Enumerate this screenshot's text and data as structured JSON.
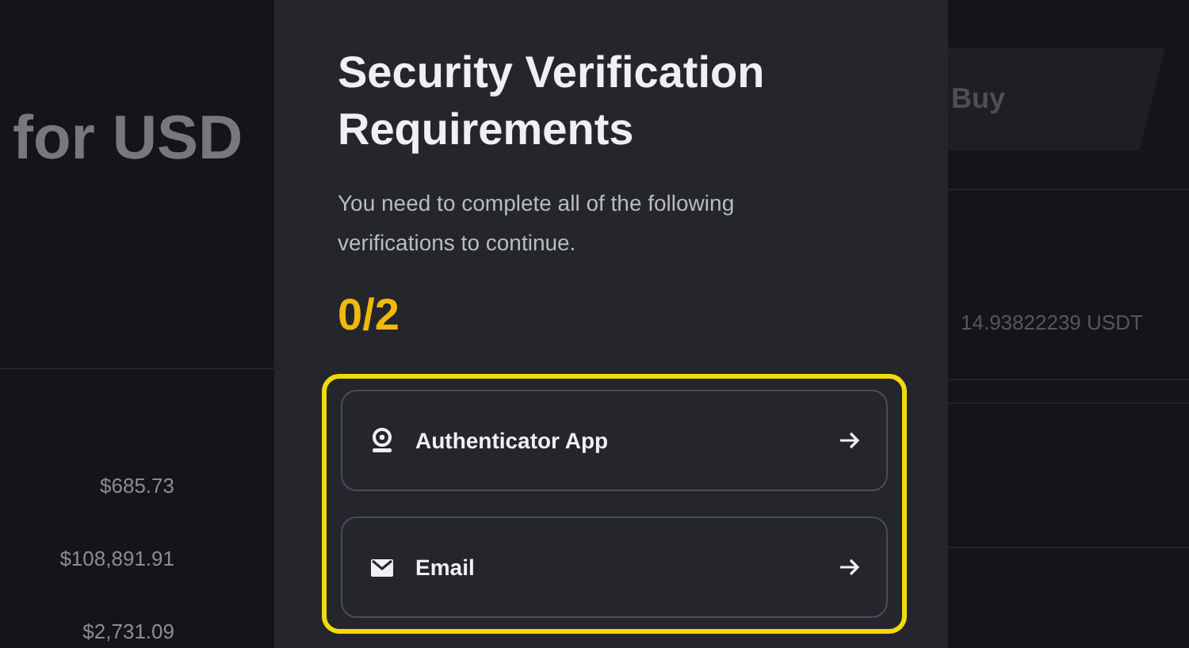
{
  "background_left": {
    "heading": "for USD",
    "prices": [
      "$685.73",
      "$108,891.91",
      "$2,731.09"
    ]
  },
  "background_right": {
    "tab": "Buy",
    "balance": "14.93822239 USDT"
  },
  "modal": {
    "title": "Security Verification Requirements",
    "description": "You need to complete all of the following verifications to continue.",
    "progress": "0/2",
    "highlighted": true,
    "methods": [
      {
        "kind": "authenticator",
        "label": "Authenticator App"
      },
      {
        "kind": "email",
        "label": "Email"
      }
    ]
  }
}
